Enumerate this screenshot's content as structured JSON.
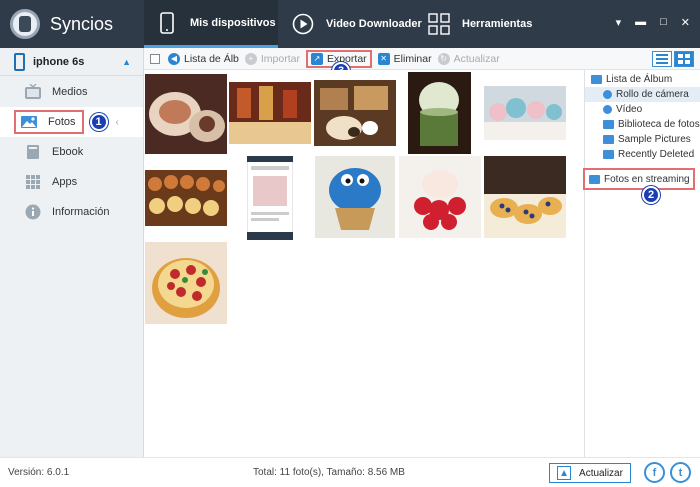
{
  "app": {
    "name": "Syncios"
  },
  "nav": {
    "tabs": [
      {
        "label": "Mis dispositivos",
        "icon": "phone-icon",
        "active": true
      },
      {
        "label": "Video Downloader",
        "icon": "play-icon",
        "active": false
      },
      {
        "label": "Herramientas",
        "icon": "grid-icon",
        "active": false
      }
    ]
  },
  "window_controls": {
    "menu": "▾",
    "minimize": "▬",
    "maximize": "□",
    "close": "✕"
  },
  "sidebar": {
    "device": {
      "name": "iphone 6s",
      "eject": "▲"
    },
    "items": [
      {
        "label": "Medios",
        "icon": "tv-icon",
        "active": false
      },
      {
        "label": "Fotos",
        "icon": "photo-icon",
        "active": true,
        "badge": "1"
      },
      {
        "label": "Ebook",
        "icon": "book-icon",
        "active": false
      },
      {
        "label": "Apps",
        "icon": "apps-grid-icon",
        "active": false
      },
      {
        "label": "Información",
        "icon": "info-icon",
        "active": false
      }
    ]
  },
  "toolbar": {
    "album_list": "Lista de Álb",
    "import": "Importar",
    "export": "Exportar",
    "export_badge": "3",
    "delete": "Eliminar",
    "refresh": "Actualizar"
  },
  "albums": {
    "root": "Lista de Álbum",
    "items": [
      {
        "label": "Rollo de cámera",
        "selected": true
      },
      {
        "label": "Vídeo",
        "selected": false
      },
      {
        "label": "Biblioteca de fotos",
        "selected": false
      },
      {
        "label": "Sample Pictures",
        "selected": false
      },
      {
        "label": "Recently Deleted",
        "selected": false
      }
    ],
    "streaming": "Fotos en streaming",
    "streaming_badge": "2"
  },
  "photos": [
    {
      "name": "dessert-plate",
      "colors": [
        "#4a2a22",
        "#c07a5a",
        "#e8d4c0"
      ]
    },
    {
      "name": "drinks-table",
      "colors": [
        "#6a2a1a",
        "#c25a2a",
        "#d8a04a"
      ]
    },
    {
      "name": "pastries-tray",
      "colors": [
        "#5a3a22",
        "#b08050",
        "#f0e0c8"
      ]
    },
    {
      "name": "matcha-parfait",
      "colors": [
        "#2a1a12",
        "#5a7a3a",
        "#e0e8d0"
      ]
    },
    {
      "name": "cupcakes-row",
      "colors": [
        "#d0d8e0",
        "#f0c0c8",
        "#80c0d0"
      ]
    },
    {
      "name": "macaron-rolls",
      "colors": [
        "#6a3a1a",
        "#d07a3a",
        "#f0d080"
      ]
    },
    {
      "name": "phone-screenshot",
      "colors": [
        "#ffffff",
        "#cccccc",
        "#2a3a4a"
      ]
    },
    {
      "name": "cookie-monster-cupcake",
      "colors": [
        "#e8e8e0",
        "#2a7ac8",
        "#c89a5a"
      ]
    },
    {
      "name": "strawberry-cake",
      "colors": [
        "#f4f0ec",
        "#d02030",
        "#f8e8e0"
      ]
    },
    {
      "name": "fruit-tarts",
      "colors": [
        "#3a2a22",
        "#e8b050",
        "#f4ecd8"
      ]
    },
    {
      "name": "berry-tart",
      "colors": [
        "#f0e0d0",
        "#c02a2a",
        "#e0a040"
      ]
    }
  ],
  "footer": {
    "version": "Versión: 6.0.1",
    "total": "Total: 11 foto(s), Tamaño: 8.56 MB",
    "update": "Actualizar",
    "facebook": "f",
    "twitter": "t"
  },
  "colors": {
    "header": "#2f3b48",
    "accent": "#2a86d1",
    "highlight": "#e26f6f",
    "badge": "#1a3fb0"
  }
}
